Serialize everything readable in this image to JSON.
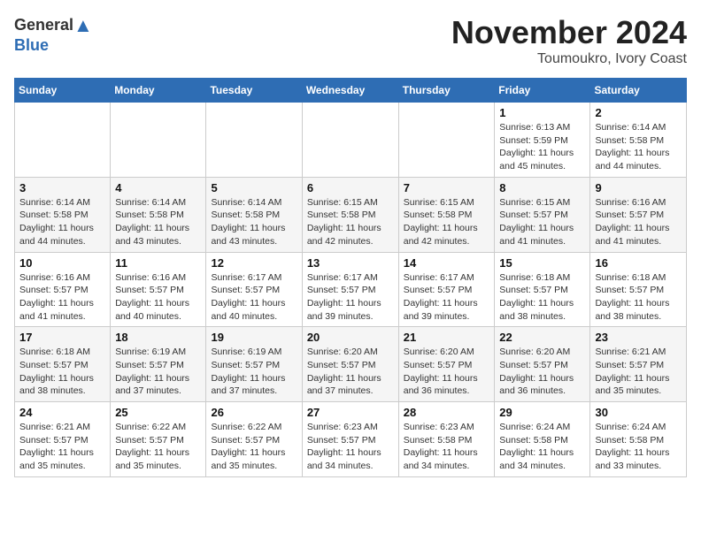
{
  "header": {
    "logo_general": "General",
    "logo_blue": "Blue",
    "month": "November 2024",
    "location": "Toumoukro, Ivory Coast"
  },
  "weekdays": [
    "Sunday",
    "Monday",
    "Tuesday",
    "Wednesday",
    "Thursday",
    "Friday",
    "Saturday"
  ],
  "weeks": [
    [
      {
        "day": "",
        "info": ""
      },
      {
        "day": "",
        "info": ""
      },
      {
        "day": "",
        "info": ""
      },
      {
        "day": "",
        "info": ""
      },
      {
        "day": "",
        "info": ""
      },
      {
        "day": "1",
        "info": "Sunrise: 6:13 AM\nSunset: 5:59 PM\nDaylight: 11 hours and 45 minutes."
      },
      {
        "day": "2",
        "info": "Sunrise: 6:14 AM\nSunset: 5:58 PM\nDaylight: 11 hours and 44 minutes."
      }
    ],
    [
      {
        "day": "3",
        "info": "Sunrise: 6:14 AM\nSunset: 5:58 PM\nDaylight: 11 hours and 44 minutes."
      },
      {
        "day": "4",
        "info": "Sunrise: 6:14 AM\nSunset: 5:58 PM\nDaylight: 11 hours and 43 minutes."
      },
      {
        "day": "5",
        "info": "Sunrise: 6:14 AM\nSunset: 5:58 PM\nDaylight: 11 hours and 43 minutes."
      },
      {
        "day": "6",
        "info": "Sunrise: 6:15 AM\nSunset: 5:58 PM\nDaylight: 11 hours and 42 minutes."
      },
      {
        "day": "7",
        "info": "Sunrise: 6:15 AM\nSunset: 5:58 PM\nDaylight: 11 hours and 42 minutes."
      },
      {
        "day": "8",
        "info": "Sunrise: 6:15 AM\nSunset: 5:57 PM\nDaylight: 11 hours and 41 minutes."
      },
      {
        "day": "9",
        "info": "Sunrise: 6:16 AM\nSunset: 5:57 PM\nDaylight: 11 hours and 41 minutes."
      }
    ],
    [
      {
        "day": "10",
        "info": "Sunrise: 6:16 AM\nSunset: 5:57 PM\nDaylight: 11 hours and 41 minutes."
      },
      {
        "day": "11",
        "info": "Sunrise: 6:16 AM\nSunset: 5:57 PM\nDaylight: 11 hours and 40 minutes."
      },
      {
        "day": "12",
        "info": "Sunrise: 6:17 AM\nSunset: 5:57 PM\nDaylight: 11 hours and 40 minutes."
      },
      {
        "day": "13",
        "info": "Sunrise: 6:17 AM\nSunset: 5:57 PM\nDaylight: 11 hours and 39 minutes."
      },
      {
        "day": "14",
        "info": "Sunrise: 6:17 AM\nSunset: 5:57 PM\nDaylight: 11 hours and 39 minutes."
      },
      {
        "day": "15",
        "info": "Sunrise: 6:18 AM\nSunset: 5:57 PM\nDaylight: 11 hours and 38 minutes."
      },
      {
        "day": "16",
        "info": "Sunrise: 6:18 AM\nSunset: 5:57 PM\nDaylight: 11 hours and 38 minutes."
      }
    ],
    [
      {
        "day": "17",
        "info": "Sunrise: 6:18 AM\nSunset: 5:57 PM\nDaylight: 11 hours and 38 minutes."
      },
      {
        "day": "18",
        "info": "Sunrise: 6:19 AM\nSunset: 5:57 PM\nDaylight: 11 hours and 37 minutes."
      },
      {
        "day": "19",
        "info": "Sunrise: 6:19 AM\nSunset: 5:57 PM\nDaylight: 11 hours and 37 minutes."
      },
      {
        "day": "20",
        "info": "Sunrise: 6:20 AM\nSunset: 5:57 PM\nDaylight: 11 hours and 37 minutes."
      },
      {
        "day": "21",
        "info": "Sunrise: 6:20 AM\nSunset: 5:57 PM\nDaylight: 11 hours and 36 minutes."
      },
      {
        "day": "22",
        "info": "Sunrise: 6:20 AM\nSunset: 5:57 PM\nDaylight: 11 hours and 36 minutes."
      },
      {
        "day": "23",
        "info": "Sunrise: 6:21 AM\nSunset: 5:57 PM\nDaylight: 11 hours and 35 minutes."
      }
    ],
    [
      {
        "day": "24",
        "info": "Sunrise: 6:21 AM\nSunset: 5:57 PM\nDaylight: 11 hours and 35 minutes."
      },
      {
        "day": "25",
        "info": "Sunrise: 6:22 AM\nSunset: 5:57 PM\nDaylight: 11 hours and 35 minutes."
      },
      {
        "day": "26",
        "info": "Sunrise: 6:22 AM\nSunset: 5:57 PM\nDaylight: 11 hours and 35 minutes."
      },
      {
        "day": "27",
        "info": "Sunrise: 6:23 AM\nSunset: 5:57 PM\nDaylight: 11 hours and 34 minutes."
      },
      {
        "day": "28",
        "info": "Sunrise: 6:23 AM\nSunset: 5:58 PM\nDaylight: 11 hours and 34 minutes."
      },
      {
        "day": "29",
        "info": "Sunrise: 6:24 AM\nSunset: 5:58 PM\nDaylight: 11 hours and 34 minutes."
      },
      {
        "day": "30",
        "info": "Sunrise: 6:24 AM\nSunset: 5:58 PM\nDaylight: 11 hours and 33 minutes."
      }
    ]
  ]
}
